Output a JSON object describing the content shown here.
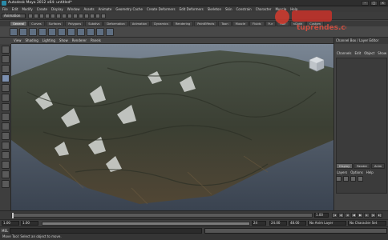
{
  "window": {
    "title": "Autodesk Maya 2012 x64: untitled*"
  },
  "menubar": [
    "File",
    "Edit",
    "Modify",
    "Create",
    "Display",
    "Window",
    "Assets",
    "Animate",
    "Geometry Cache",
    "Create Deformers",
    "Edit Deformers",
    "Skeleton",
    "Skin",
    "Constrain",
    "Character",
    "Muscle",
    "Help"
  ],
  "statusline": {
    "mode": "Animation"
  },
  "shelf": {
    "tabs": [
      "General",
      "Curves",
      "Surfaces",
      "Polygons",
      "Subdivs",
      "Deformation",
      "Animation",
      "Dynamics",
      "Rendering",
      "PaintEffects",
      "Toon",
      "Muscle",
      "Fluids",
      "Fur",
      "Hair",
      "nCloth",
      "Custom"
    ],
    "active_tab": 0
  },
  "panel_menu": [
    "View",
    "Shading",
    "Lighting",
    "Show",
    "Renderer",
    "Panels"
  ],
  "right_panel": {
    "header": "Channel Box / Layer Editor",
    "menu": [
      "Channels",
      "Edit",
      "Object",
      "Show"
    ],
    "layer_tabs": [
      "Display",
      "Render",
      "Anim"
    ],
    "layer_menu": [
      "Layers",
      "Options",
      "Help"
    ]
  },
  "time_slider": {
    "current_frame": "1.00",
    "playhead": 0.0
  },
  "range": {
    "start": "1.00",
    "inner_start": "1.00",
    "inner_end": "24",
    "end_current": "24.00",
    "end": "48.00",
    "anim_layer": "No Anim Layer",
    "char_set": "No Character Set"
  },
  "cmdline": {
    "label": "MEL"
  },
  "help_line": "Move Tool: Select an object to move.",
  "watermark": {
    "text": "tuprendes.com"
  },
  "colors": {
    "viewport_top": "#7a8694",
    "viewport_bottom": "#3a4350",
    "active_tab": "#6a6a6a"
  }
}
